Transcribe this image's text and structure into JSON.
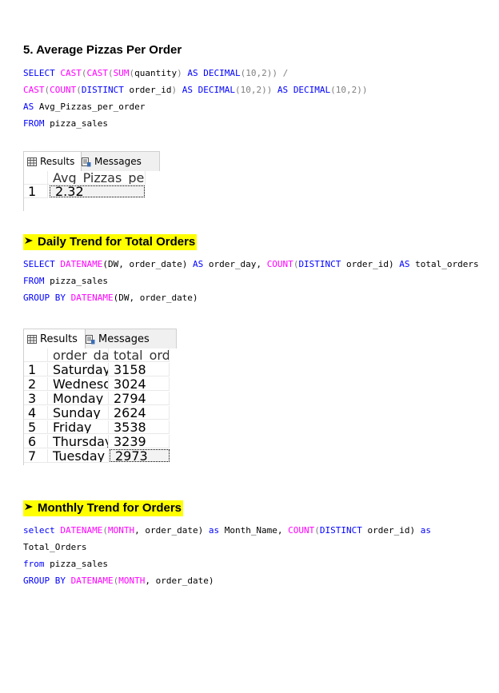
{
  "sections": {
    "s5": {
      "heading": "5. Average Pizzas Per Order",
      "code": {
        "l1": {
          "a": "SELECT",
          "b": " ",
          "c": "CAST",
          "d": "(",
          "e": "CAST",
          "f": "(",
          "g": "SUM",
          "h": "(",
          "i": "quantity",
          "j": ")",
          "k": " AS ",
          "l": "DECIMAL",
          "m": "(10,2)) /"
        },
        "l2": {
          "a": "CAST",
          "b": "(",
          "c": "COUNT",
          "d": "(",
          "e": "DISTINCT",
          "f": " order_id",
          "g": ")",
          "h": " AS ",
          "i": "DECIMAL",
          "j": "(10,2))",
          "k": " AS ",
          "l": "DECIMAL",
          "m": "(10,2))"
        },
        "l3": {
          "a": "AS",
          "b": " Avg_Pizzas_per_order"
        },
        "l4": {
          "a": "FROM",
          "b": " pizza_sales"
        }
      },
      "results": {
        "tab_results": "Results",
        "tab_messages": "Messages",
        "columns": [
          "Avg_Pizzas_per_order"
        ],
        "rows": [
          [
            "1",
            "2.32"
          ]
        ]
      }
    },
    "daily": {
      "heading": "Daily Trend for Total Orders",
      "code": {
        "l1": {
          "a": "SELECT",
          "b": " ",
          "c": "DATENAME",
          "d": "(DW, order_date) ",
          "e": "AS",
          "f": " order_day, ",
          "g": "COUNT",
          "h": "(",
          "i": "DISTINCT",
          "j": " order_id) ",
          "k": "AS",
          "l": " total_orders"
        },
        "l2": {
          "a": "FROM",
          "b": " pizza_sales"
        },
        "l3": {
          "a": "GROUP BY",
          "b": " ",
          "c": "DATENAME",
          "d": "(DW, order_date)"
        }
      },
      "results": {
        "tab_results": "Results",
        "tab_messages": "Messages",
        "columns": [
          "order_day",
          "total_orders"
        ],
        "rows": [
          [
            "1",
            "Saturday",
            "3158"
          ],
          [
            "2",
            "Wednesday",
            "3024"
          ],
          [
            "3",
            "Monday",
            "2794"
          ],
          [
            "4",
            "Sunday",
            "2624"
          ],
          [
            "5",
            "Friday",
            "3538"
          ],
          [
            "6",
            "Thursday",
            "3239"
          ],
          [
            "7",
            "Tuesday",
            "2973"
          ]
        ]
      }
    },
    "monthly": {
      "heading": "Monthly Trend for Orders",
      "code": {
        "l1": {
          "a": "select",
          "b": " ",
          "c": "DATENAME",
          "d": "(",
          "e": "MONTH",
          "f": ", order_date) ",
          "g": "as",
          "h": " Month_Name, ",
          "i": "COUNT",
          "j": "(",
          "k": "DISTINCT",
          "l": " order_id) ",
          "m": "as"
        },
        "l2": {
          "a": "Total_Orders"
        },
        "l3": {
          "a": "from",
          "b": " pizza_sales"
        },
        "l4": {
          "a": "GROUP BY",
          "b": " ",
          "c": "DATENAME",
          "d": "(",
          "e": "MONTH",
          "f": ", order_date)"
        }
      }
    }
  },
  "colors": {
    "keyword": "#0000ff",
    "function": "#ff00ff",
    "highlight": "#ffff00"
  },
  "icons": {
    "results": "grid-icon",
    "messages": "messages-icon",
    "bullet": "arrow-bullet-icon"
  }
}
